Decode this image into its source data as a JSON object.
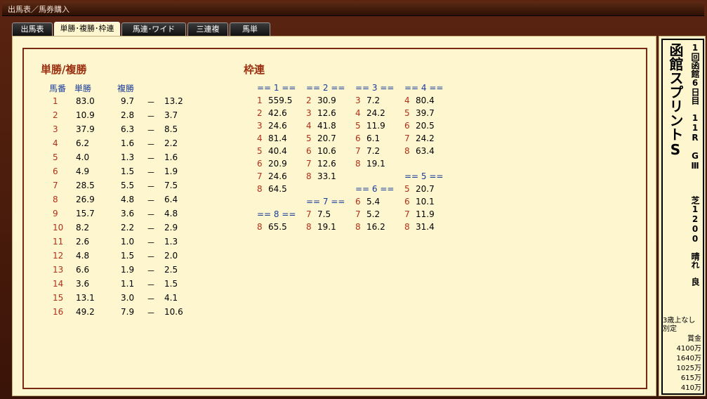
{
  "window": {
    "title": "出馬表／馬券購入"
  },
  "tabs": [
    {
      "label": "出馬表"
    },
    {
      "label": "単勝･複勝･枠連"
    },
    {
      "label": "馬連･ワイド"
    },
    {
      "label": "三連複"
    },
    {
      "label": "馬単"
    }
  ],
  "win_place": {
    "title": "単勝/複勝",
    "headers": {
      "num": "馬番",
      "win": "単勝",
      "place": "複勝"
    },
    "dash": "－",
    "rows": [
      {
        "num": "1",
        "win": "83.0",
        "p1": "9.7",
        "p2": "13.2"
      },
      {
        "num": "2",
        "win": "10.9",
        "p1": "2.8",
        "p2": "3.7"
      },
      {
        "num": "3",
        "win": "37.9",
        "p1": "6.3",
        "p2": "8.5"
      },
      {
        "num": "4",
        "win": "6.2",
        "p1": "1.6",
        "p2": "2.2"
      },
      {
        "num": "5",
        "win": "4.0",
        "p1": "1.3",
        "p2": "1.6"
      },
      {
        "num": "6",
        "win": "4.9",
        "p1": "1.5",
        "p2": "1.9"
      },
      {
        "num": "7",
        "win": "28.5",
        "p1": "5.5",
        "p2": "7.5"
      },
      {
        "num": "8",
        "win": "26.9",
        "p1": "4.8",
        "p2": "6.4"
      },
      {
        "num": "9",
        "win": "15.7",
        "p1": "3.6",
        "p2": "4.8"
      },
      {
        "num": "10",
        "win": "8.2",
        "p1": "2.2",
        "p2": "2.9"
      },
      {
        "num": "11",
        "win": "2.6",
        "p1": "1.0",
        "p2": "1.3"
      },
      {
        "num": "12",
        "win": "4.8",
        "p1": "1.5",
        "p2": "2.0"
      },
      {
        "num": "13",
        "win": "6.6",
        "p1": "1.9",
        "p2": "2.5"
      },
      {
        "num": "14",
        "win": "3.6",
        "p1": "1.1",
        "p2": "1.5"
      },
      {
        "num": "15",
        "win": "13.1",
        "p1": "3.0",
        "p2": "4.1"
      },
      {
        "num": "16",
        "win": "49.2",
        "p1": "7.9",
        "p2": "10.6"
      }
    ]
  },
  "bracket": {
    "title": "枠連",
    "groups": [
      {
        "label": "== 1 ==",
        "col": 0,
        "row": 0,
        "entries": [
          [
            "1",
            "559.5"
          ],
          [
            "2",
            "42.6"
          ],
          [
            "3",
            "24.6"
          ],
          [
            "4",
            "81.4"
          ],
          [
            "5",
            "40.4"
          ],
          [
            "6",
            "20.9"
          ],
          [
            "7",
            "24.6"
          ],
          [
            "8",
            "64.5"
          ]
        ]
      },
      {
        "label": "== 2 ==",
        "col": 1,
        "row": 0,
        "entries": [
          [
            "2",
            "30.9"
          ],
          [
            "3",
            "12.6"
          ],
          [
            "4",
            "41.8"
          ],
          [
            "5",
            "20.7"
          ],
          [
            "6",
            "10.6"
          ],
          [
            "7",
            "12.6"
          ],
          [
            "8",
            "33.1"
          ]
        ]
      },
      {
        "label": "== 3 ==",
        "col": 2,
        "row": 0,
        "entries": [
          [
            "3",
            "7.2"
          ],
          [
            "4",
            "24.2"
          ],
          [
            "5",
            "11.9"
          ],
          [
            "6",
            "6.1"
          ],
          [
            "7",
            "7.2"
          ],
          [
            "8",
            "19.1"
          ]
        ]
      },
      {
        "label": "== 4 ==",
        "col": 3,
        "row": 0,
        "entries": [
          [
            "4",
            "80.4"
          ],
          [
            "5",
            "39.7"
          ],
          [
            "6",
            "20.5"
          ],
          [
            "7",
            "24.2"
          ],
          [
            "8",
            "63.4"
          ]
        ]
      },
      {
        "label": "== 5 ==",
        "col": 3,
        "row": 7,
        "entries": [
          [
            "5",
            "20.7"
          ],
          [
            "6",
            "10.1"
          ],
          [
            "7",
            "11.9"
          ],
          [
            "8",
            "31.4"
          ]
        ]
      },
      {
        "label": "== 6 ==",
        "col": 2,
        "row": 8,
        "entries": [
          [
            "6",
            "5.4"
          ],
          [
            "7",
            "5.2"
          ],
          [
            "8",
            "16.2"
          ]
        ]
      },
      {
        "label": "== 7 ==",
        "col": 1,
        "row": 9,
        "entries": [
          [
            "7",
            "7.5"
          ],
          [
            "8",
            "19.1"
          ]
        ]
      },
      {
        "label": "== 8 ==",
        "col": 0,
        "row": 10,
        "entries": [
          [
            "8",
            "65.5"
          ]
        ]
      }
    ]
  },
  "race": {
    "name": "函館スプリントS",
    "meeting": "1回函館6日目",
    "race_no": "11R",
    "grade": "GⅢ",
    "course": "芝1200",
    "weather": "晴れ",
    "going": "良",
    "conditions": [
      "3歳上なし",
      "別定"
    ],
    "prize_label": "賞金",
    "prizes": [
      "4100万",
      "1640万",
      "1025万",
      "615万",
      "410万"
    ]
  }
}
